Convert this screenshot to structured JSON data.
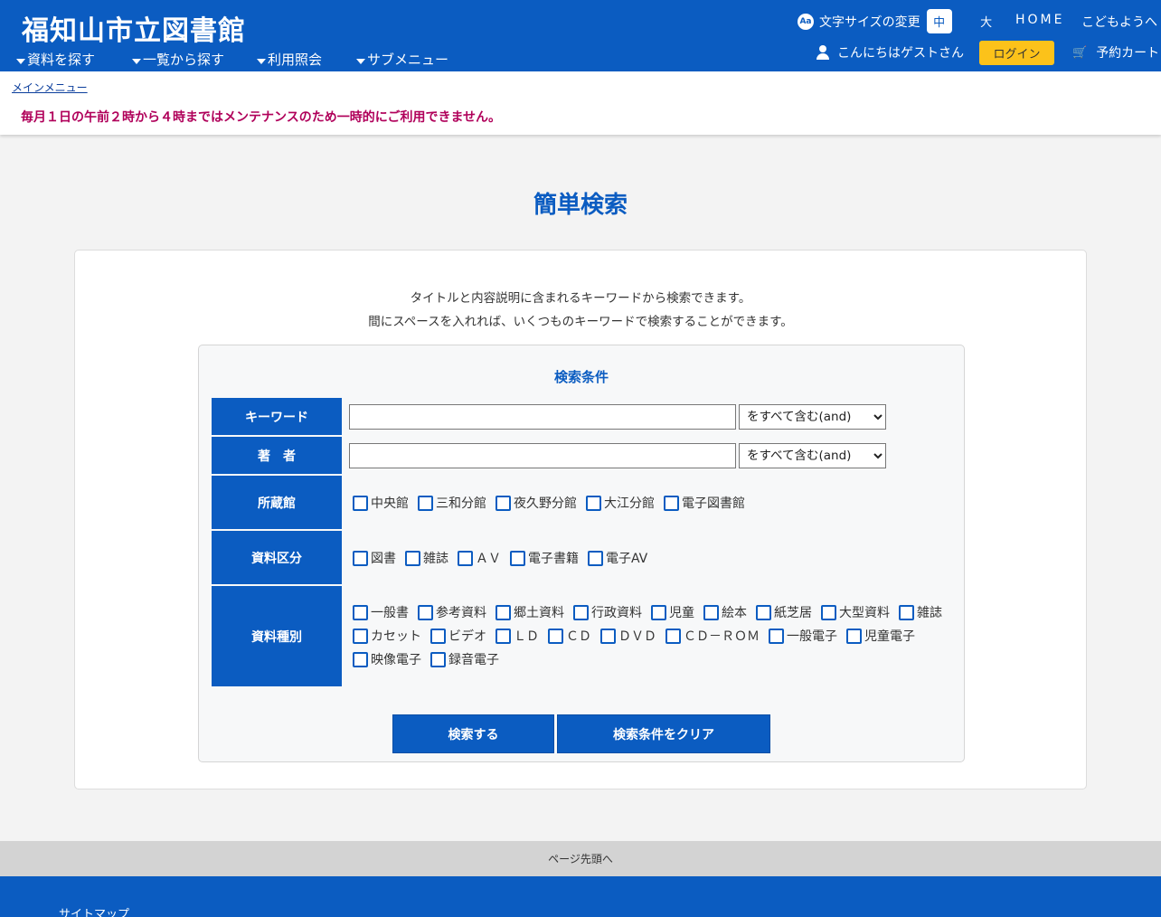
{
  "header": {
    "site_title": "福知山市立図書館",
    "nav": [
      "資料を探す",
      "一覧から探す",
      "利用照会",
      "サブメニュー"
    ],
    "font_size_label": "文字サイズの変更",
    "font_icon": "Aa",
    "font_medium": "中",
    "font_large": "大",
    "home": "HOME",
    "kids": "こどもようへ",
    "greeting": "こんにちはゲストさん",
    "login": "ログイン",
    "cart_icon": "🛒",
    "cart": "予約カート"
  },
  "notice": {
    "breadcrumb": "メインメニュー",
    "message": "毎月１日の午前２時から４時まではメンテナンスのため一時的にご利用できません。"
  },
  "main": {
    "page_title": "簡単検索",
    "desc_line1": "タイトルと内容説明に含まれるキーワードから検索できます。",
    "desc_line2": "間にスペースを入れれば、いくつものキーワードで検索することができます。",
    "conditions_title": "検索条件",
    "labels": {
      "keyword": "キーワード",
      "author": "著　者",
      "library": "所蔵館",
      "material_class": "資料区分",
      "material_type": "資料種別"
    },
    "keyword_value": "",
    "author_value": "",
    "match_option": "をすべて含む(and)",
    "libraries": [
      "中央館",
      "三和分館",
      "夜久野分館",
      "大江分館",
      "電子図書館"
    ],
    "material_classes": [
      "図書",
      "雑誌",
      "ＡＶ",
      "電子書籍",
      "電子AV"
    ],
    "material_types_row1": [
      "一般書",
      "参考資料",
      "郷土資料",
      "行政資料",
      "児童",
      "絵本",
      "紙芝居",
      "大型資料",
      "雑誌"
    ],
    "material_types_row2": [
      "カセット",
      "ビデオ",
      "ＬＤ",
      "ＣＤ",
      "ＤＶＤ",
      "ＣＤ－ＲＯＭ",
      "一般電子",
      "児童電子"
    ],
    "material_types_row3": [
      "映像電子",
      "録音電子"
    ],
    "search_button": "検索する",
    "clear_button": "検索条件をクリア"
  },
  "footer": {
    "to_top": "ページ先頭へ",
    "sitemap": "サイトマップ"
  },
  "colors": {
    "brand_blue": "#0b5cc1",
    "login_yellow": "#fcc21a",
    "notice_red": "#b0005a"
  }
}
